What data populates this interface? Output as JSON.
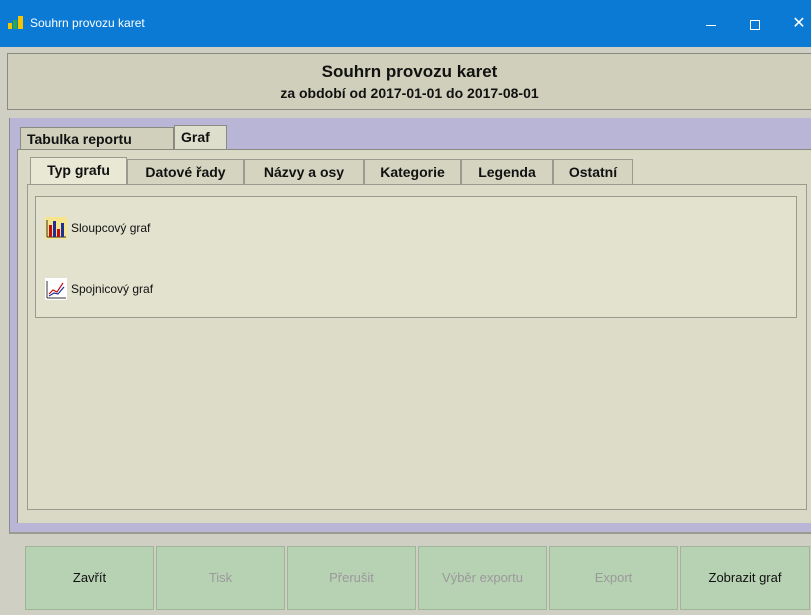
{
  "window": {
    "title": "Souhrn provozu karet",
    "controls": {
      "minimize": "",
      "maximize": "",
      "close": "✕"
    }
  },
  "header": {
    "title": "Souhrn provozu karet",
    "subtitle": "za období od 2017-01-01 do 2017-08-01"
  },
  "outer_tabs": [
    {
      "label": "Tabulka reportu",
      "active": false
    },
    {
      "label": "Graf",
      "active": true
    }
  ],
  "inner_tabs": [
    {
      "label": "Typ grafu",
      "active": true
    },
    {
      "label": "Datové řady",
      "active": false
    },
    {
      "label": "Názvy a osy",
      "active": false
    },
    {
      "label": "Kategorie",
      "active": false
    },
    {
      "label": "Legenda",
      "active": false
    },
    {
      "label": "Ostatní",
      "active": false
    }
  ],
  "chart_types": [
    {
      "label": "Sloupcový graf",
      "icon": "bar-chart-icon"
    },
    {
      "label": "Spojnicový graf",
      "icon": "line-chart-icon"
    }
  ],
  "footer": {
    "buttons": [
      {
        "label": "Zavřít",
        "enabled": true
      },
      {
        "label": "Tisk",
        "enabled": false
      },
      {
        "label": "Přerušit",
        "enabled": false
      },
      {
        "label": "Výběr exportu",
        "enabled": false
      },
      {
        "label": "Export",
        "enabled": false
      },
      {
        "label": "Zobrazit graf",
        "enabled": true
      }
    ]
  },
  "colors": {
    "titlebar": "#0a7ad4",
    "button_green": "#b7d1b3",
    "tab_band": "#b8b5d6"
  }
}
